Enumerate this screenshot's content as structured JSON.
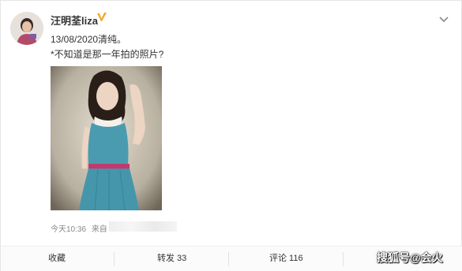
{
  "post": {
    "user_name": "汪明荃liza",
    "line1": "13/08/2020清纯。",
    "line2": "*不知道是那一年拍的照片?",
    "time": "今天10:36",
    "source_prefix": "来自"
  },
  "actions": {
    "favorite": "收藏",
    "repost": "转发 33",
    "comment": "评论 116"
  },
  "watermark": "搜狐号@会火",
  "icons": {
    "verified": "verified-badge-icon",
    "chevron": "chevron-down-icon"
  },
  "colors": {
    "verified": "#f5a623",
    "dress": "#4a9bb0",
    "belt": "#c2396e"
  }
}
